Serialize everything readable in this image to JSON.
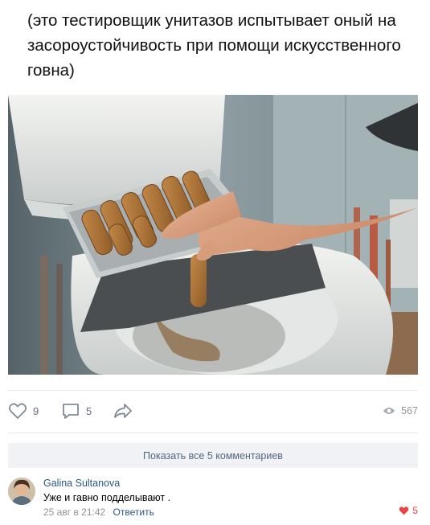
{
  "post": {
    "text": "(это тестировщик унитазов испытывает оный на засороустойчивость при помощи искусственного говна)"
  },
  "actions": {
    "likes": "9",
    "comments": "5",
    "views": "567",
    "icons": [
      "heart-icon",
      "comment-icon",
      "share-icon",
      "eye-icon"
    ],
    "icon_color": "#828a99"
  },
  "comments_block": {
    "show_all_label": "Показать все 5 комментариев"
  },
  "comment": {
    "author": "Galina Sultanova",
    "text": "Уже и гавно подделывают .",
    "timestamp": "25 авг в 21:42",
    "reply_label": "Ответить",
    "likes": "5",
    "like_color": "#e64646"
  }
}
